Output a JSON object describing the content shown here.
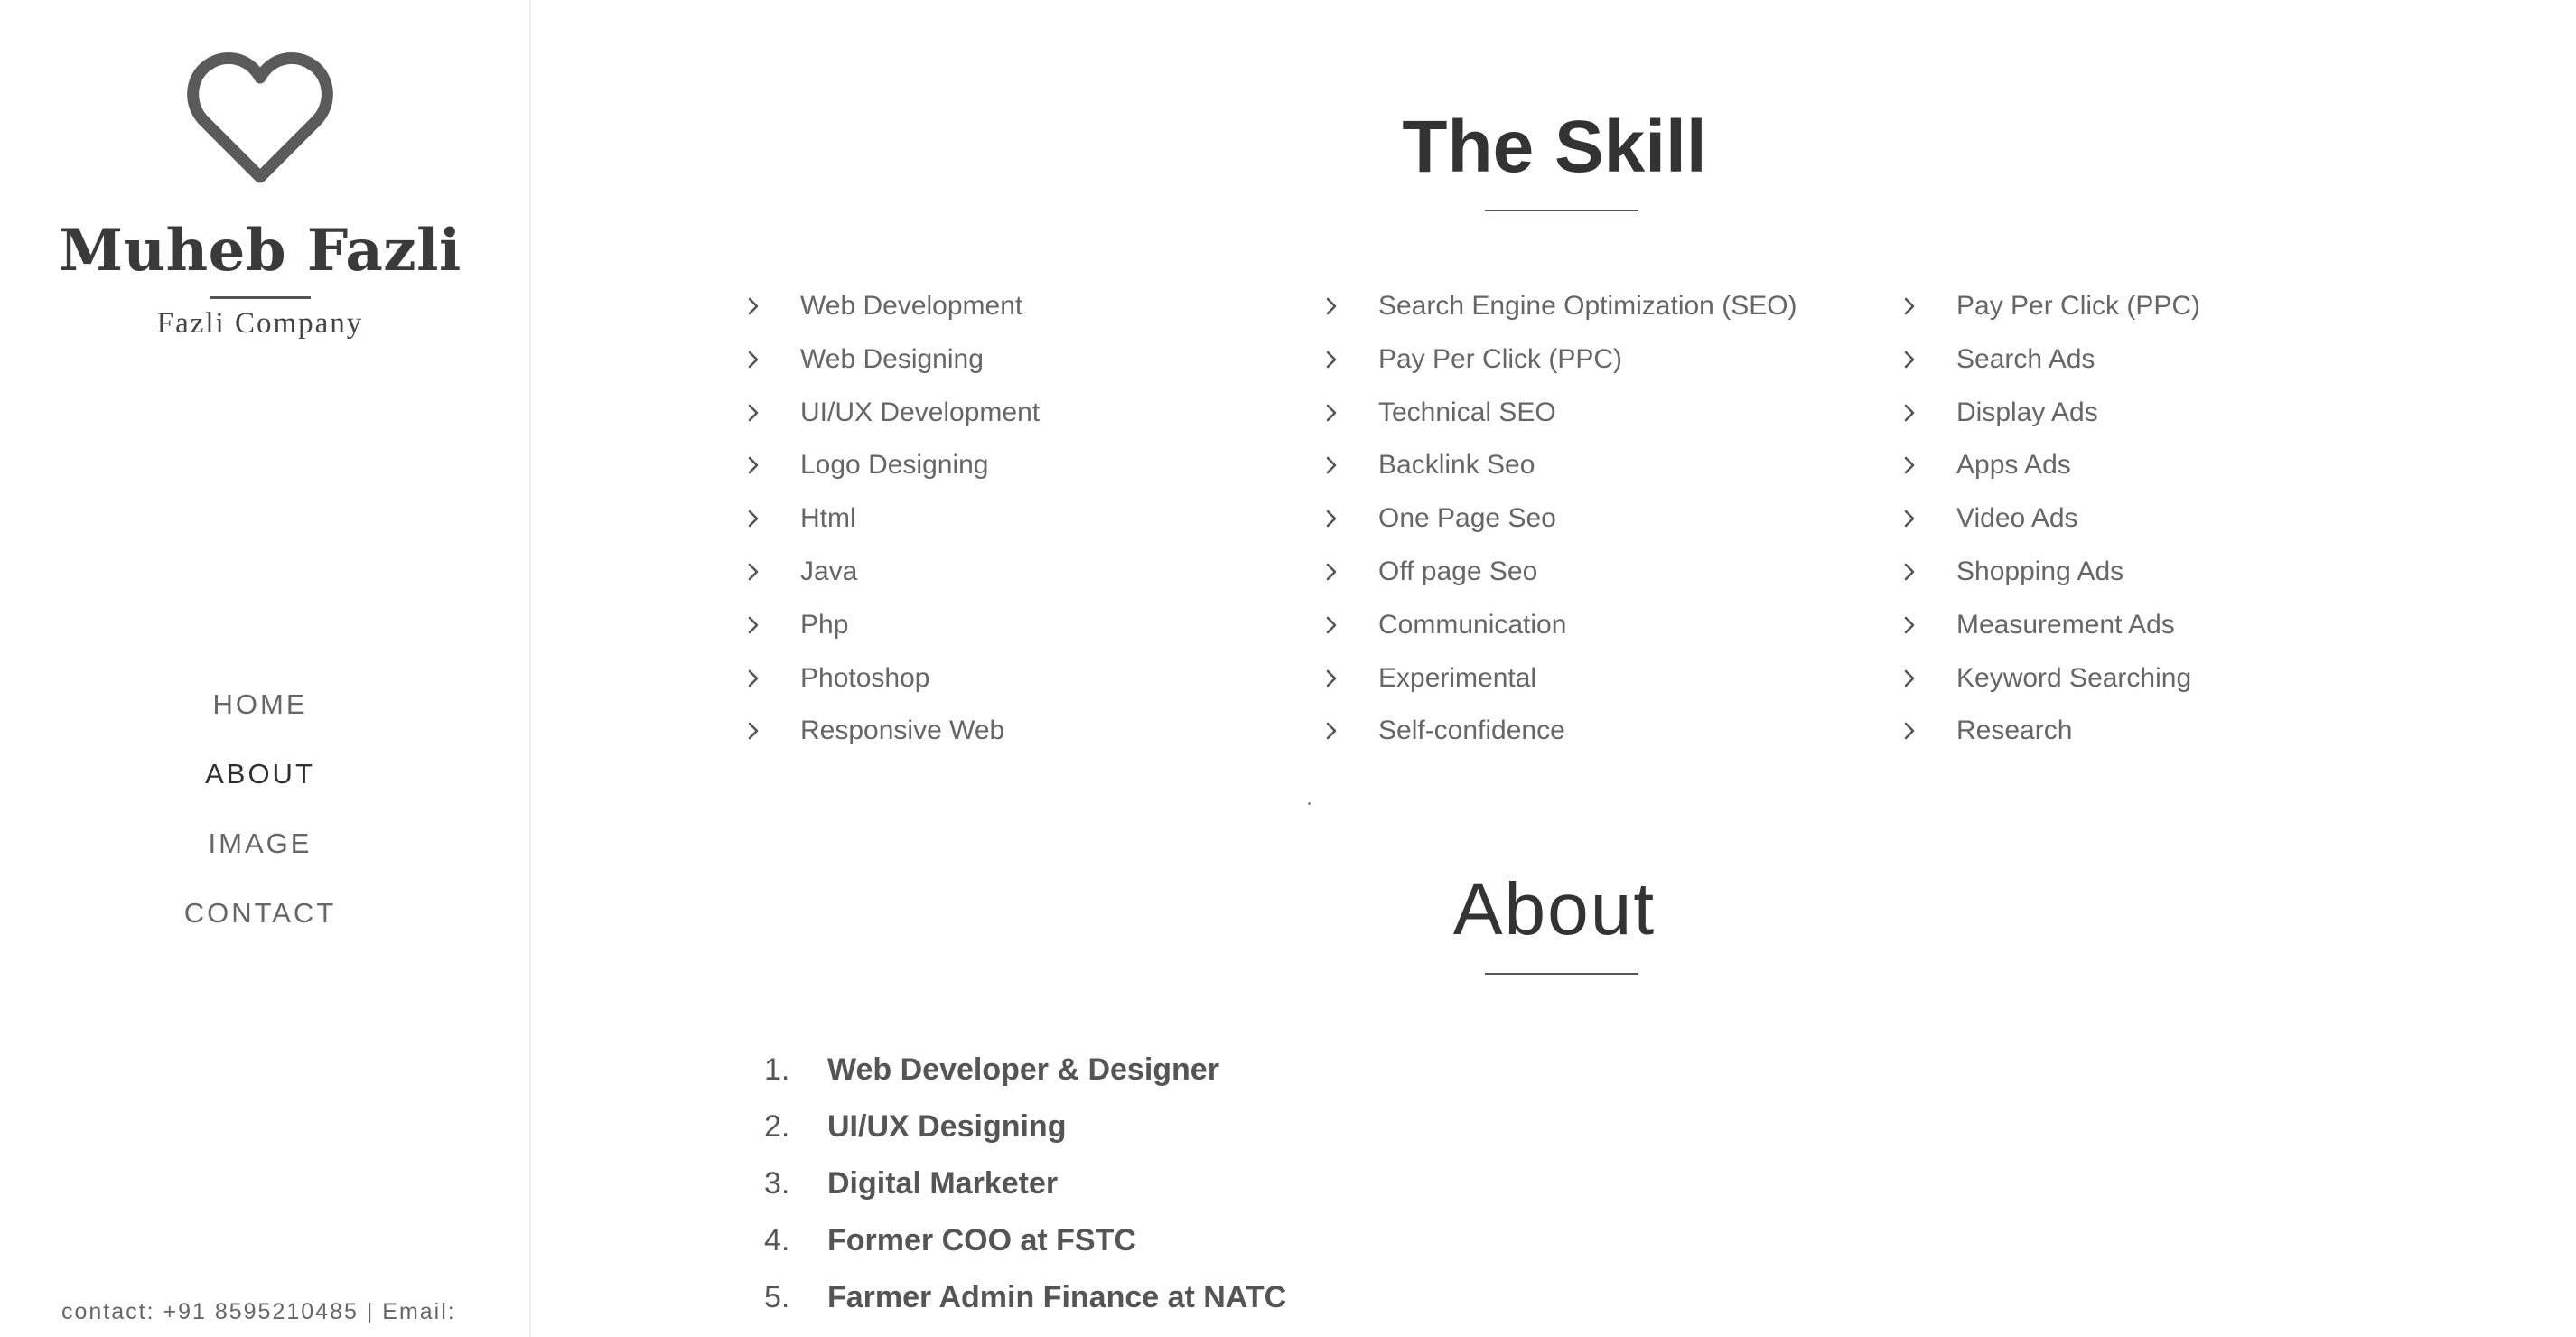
{
  "sidebar": {
    "logo_icon": "heart-outline-icon",
    "brand_name": "Muheb Fazli",
    "tagline": "Fazli Company",
    "nav": [
      {
        "label": "HOME",
        "active": false
      },
      {
        "label": "ABOUT",
        "active": true
      },
      {
        "label": "IMAGE",
        "active": false
      },
      {
        "label": "CONTACT",
        "active": false
      }
    ],
    "contact_line": "contact: +91 8595210485 | Email:"
  },
  "skills": {
    "title": "The Skill",
    "columns": [
      [
        "Web Development",
        "Web Designing",
        "UI/UX Development",
        "Logo Designing",
        "Html",
        "Java",
        "Php",
        "Photoshop",
        "Responsive Web"
      ],
      [
        "Search Engine Optimization (SEO)",
        "Pay Per Click (PPC)",
        "Technical SEO",
        "Backlink Seo",
        "One Page Seo",
        "Off page Seo",
        "Communication",
        "Experimental",
        "Self-confidence"
      ],
      [
        "Pay Per Click (PPC)",
        "Search Ads",
        "Display Ads",
        "Apps Ads",
        "Video Ads",
        "Shopping Ads",
        "Measurement Ads",
        "Keyword Searching",
        "Research"
      ]
    ],
    "bullet_icon": "chevron-right-icon"
  },
  "about": {
    "title": "About",
    "items": [
      {
        "num": "1.",
        "text": "Web Developer & Designer"
      },
      {
        "num": "2.",
        "text": "UI/UX Designing"
      },
      {
        "num": "3.",
        "text": "Digital Marketer"
      },
      {
        "num": "4.",
        "text": "Former COO at FSTC"
      },
      {
        "num": "5.",
        "text": "Farmer Admin Finance at NATC"
      }
    ]
  },
  "colors": {
    "heading": "#333333",
    "body_text": "#666666",
    "divider": "#eeeeee",
    "background": "#ffffff"
  }
}
